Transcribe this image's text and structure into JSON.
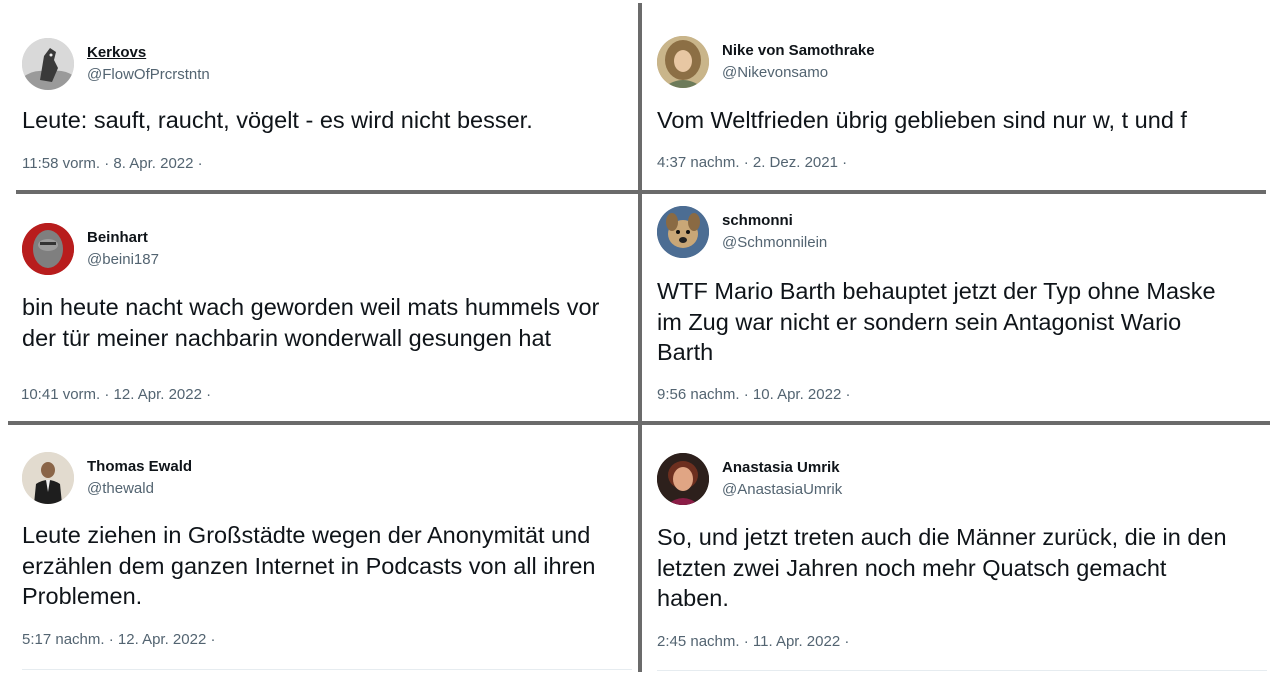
{
  "tweets": [
    {
      "display_name": "Kerkovs",
      "handle": "@FlowOfPrcrstntn",
      "text": "Leute: sauft, raucht, vögelt - es wird nicht besser.",
      "meta": "11:58 vorm. · 8. Apr. 2022 ·",
      "avatar_icon": "horse-avatar"
    },
    {
      "display_name": "Nike von Samothrake",
      "handle": "@Nikevonsamo",
      "text": "Vom Weltfrieden übrig geblieben sind nur w, t und f",
      "meta": "4:37 nachm. · 2. Dez. 2021 ·",
      "avatar_icon": "woman-avatar"
    },
    {
      "display_name": "Beinhart",
      "handle": "@beini187",
      "text": "bin heute nacht wach geworden weil mats hummels vor\nder tür meiner nachbarin wonderwall gesungen hat",
      "meta": "10:41 vorm. · 12. Apr. 2022 ·",
      "avatar_icon": "man-avatar"
    },
    {
      "display_name": "schmonni",
      "handle": "@Schmonnilein",
      "text": "WTF Mario Barth behauptet jetzt der Typ ohne Maske\nim Zug war nicht er sondern sein Antagonist Wario\nBarth",
      "meta": "9:56 nachm. · 10. Apr. 2022 ·",
      "avatar_icon": "dog-avatar"
    },
    {
      "display_name": "Thomas Ewald",
      "handle": "@thewald",
      "text": "Leute ziehen in Großstädte wegen der Anonymität und\nerzählen dem ganzen Internet in Podcasts von all ihren\nProblemen.",
      "meta": "5:17 nachm. · 12. Apr. 2022 ·",
      "avatar_icon": "man-suit-avatar"
    },
    {
      "display_name": "Anastasia Umrik",
      "handle": "@AnastasiaUmrik",
      "text": "So, und jetzt treten auch die Männer zurück, die in den\nletzten zwei Jahren noch mehr Quatsch gemacht\nhaben.",
      "meta": "2:45 nachm. · 11. Apr. 2022 ·",
      "avatar_icon": "woman-portrait-avatar"
    }
  ],
  "colors": {
    "text": "#0f1419",
    "secondary": "#536471",
    "divider": "#6b6b6b"
  }
}
